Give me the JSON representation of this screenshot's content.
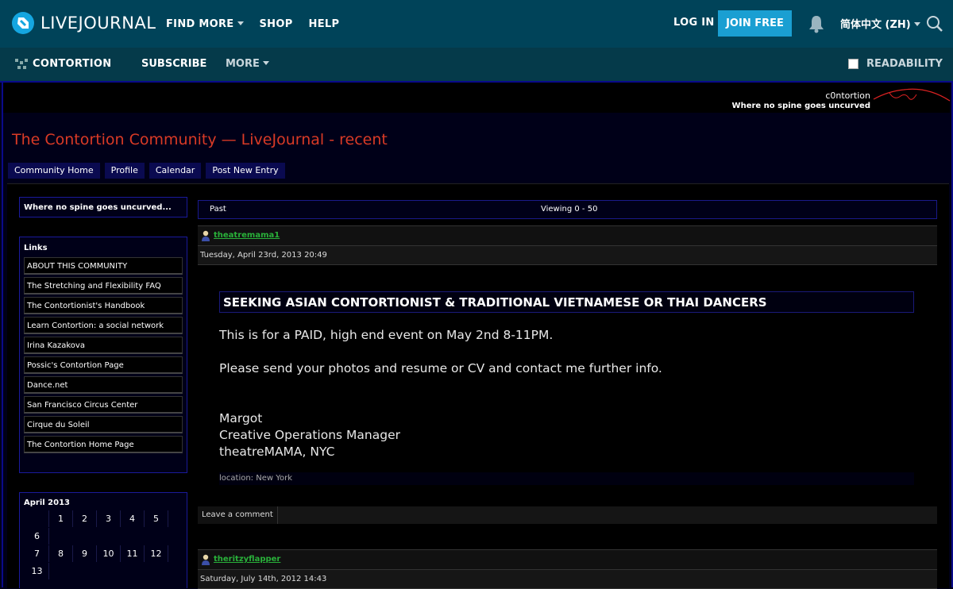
{
  "topbar": {
    "logo_text": "LIVEJOURNAL",
    "nav": [
      "FIND MORE",
      "SHOP",
      "HELP"
    ],
    "login": "LOG IN",
    "join": "JOIN FREE",
    "language": "简体中文 (ZH)"
  },
  "subbar": {
    "community": "CONTORTION",
    "subscribe": "SUBSCRIBE",
    "more": "MORE",
    "readability": "READABILITY"
  },
  "header": {
    "username": "c0ntortion",
    "tagline": "Where no spine goes uncurved"
  },
  "page_title": "The Contortion Community — LiveJournal - recent",
  "tabs": [
    "Community Home",
    "Profile",
    "Calendar",
    "Post New Entry"
  ],
  "sidebar": {
    "tagline_box": "Where no spine goes uncurved...",
    "links_heading": "Links",
    "links": [
      "ABOUT THIS COMMUNITY",
      "The Stretching and Flexibility FAQ",
      "The Contortionist's Handbook",
      "Learn Contortion: a social network",
      "Irina Kazakova",
      "Possic's Contortion Page",
      "Dance.net",
      "San Francisco Circus Center",
      "Cirque du Soleil",
      "The Contortion Home Page"
    ],
    "calendar_heading": "April 2013",
    "calendar_rows": [
      [
        "",
        "1",
        "2",
        "3",
        "4",
        "5"
      ],
      [
        "6"
      ],
      [
        "7",
        "8",
        "9",
        "10",
        "11",
        "12"
      ],
      [
        "13"
      ]
    ]
  },
  "viewbar": {
    "past": "Past",
    "viewing": "Viewing 0 - 50"
  },
  "entries": [
    {
      "user": "theatremama1",
      "date": "Tuesday, April 23rd, 2013 20:49",
      "subject": "SEEKING ASIAN CONTORTIONIST & TRADITIONAL VIETNAMESE OR THAI DANCERS",
      "line1": "This is for a PAID, high end event on May 2nd 8-11PM.",
      "line2": "Please send your photos and resume or CV and contact me further info.",
      "sig1": "Margot",
      "sig2": "Creative Operations Manager",
      "sig3": "theatreMAMA, NYC",
      "location": "location: New York",
      "comment_label": "Leave a comment"
    },
    {
      "user": "theritzyflapper",
      "date": "Saturday, July 14th, 2012 14:43"
    }
  ]
}
